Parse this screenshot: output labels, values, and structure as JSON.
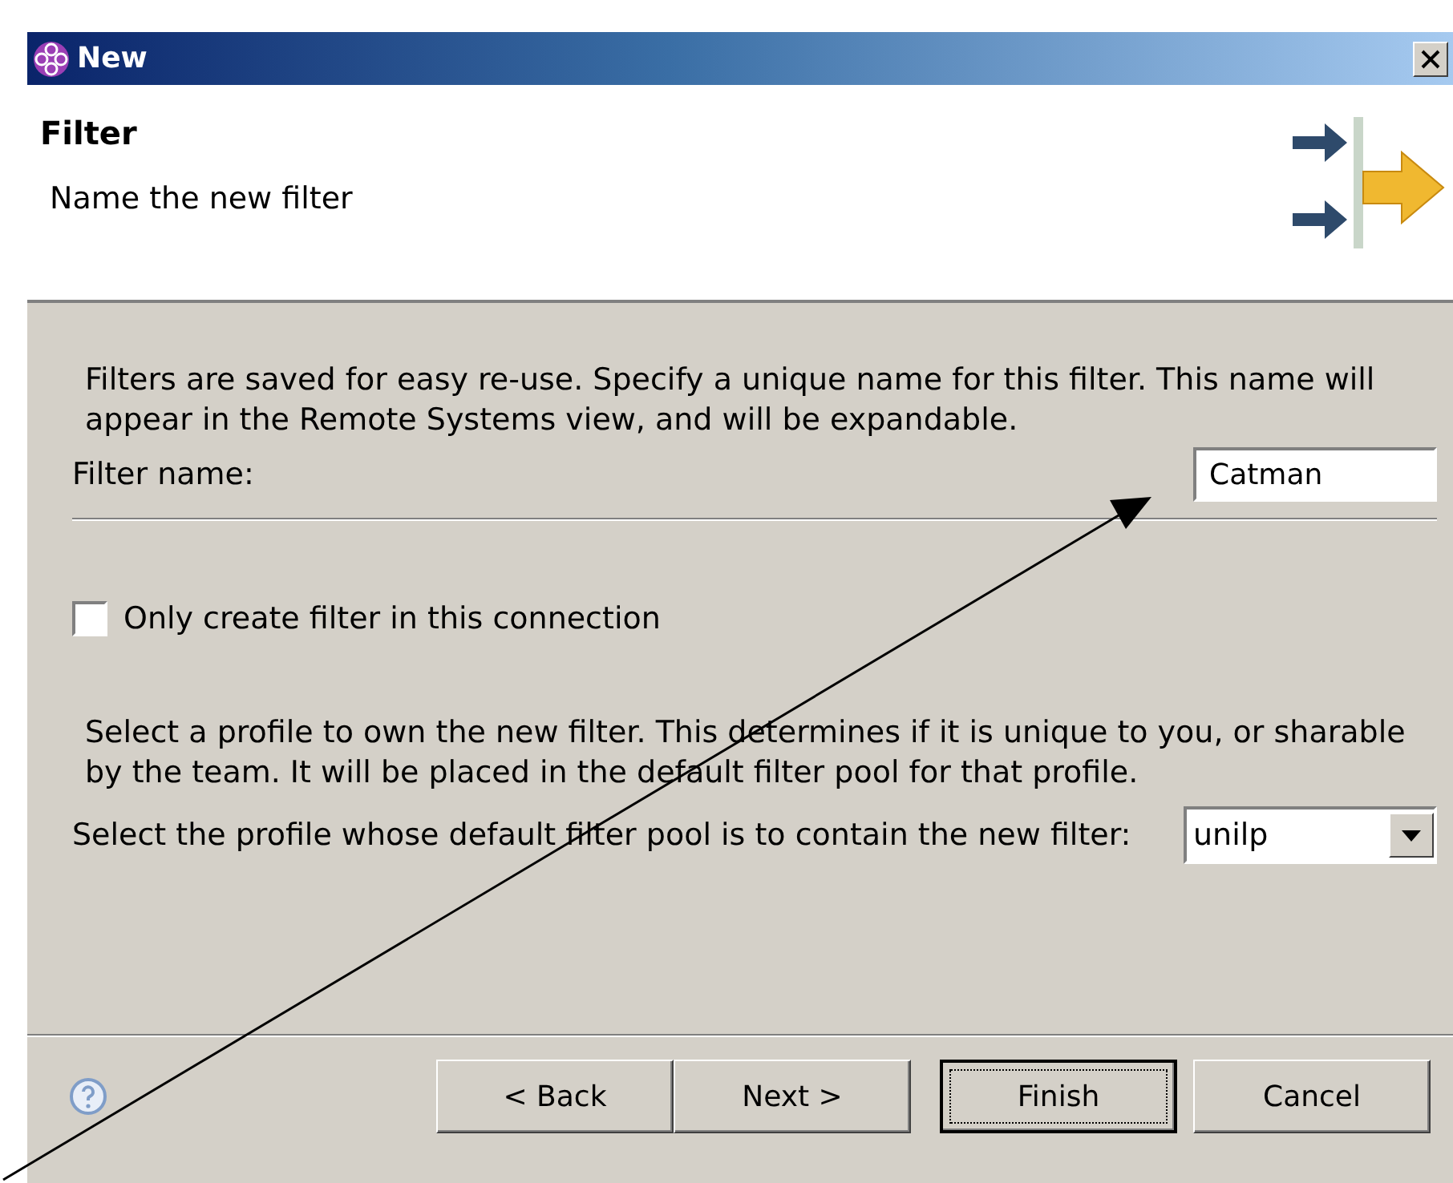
{
  "window": {
    "title": "New"
  },
  "header": {
    "title": "Filter",
    "subtitle": "Name the new filter"
  },
  "intro": "Filters are saved for easy re-use. Specify a unique name for this filter. This name will appear in the Remote Systems view, and will be expandable.",
  "filter_name": {
    "label": "Filter name:",
    "value": "Catman"
  },
  "only_connection": {
    "label": "Only create filter in this connection",
    "checked": false
  },
  "profile_intro": "Select a profile to own the new filter. This determines if it is unique to you, or sharable by the team. It will be placed in the default filter pool for that profile.",
  "profile": {
    "label": "Select the profile whose default filter pool is to contain the new filter:",
    "value": "unilp"
  },
  "buttons": [
    {
      "label": "< Back",
      "default": false
    },
    {
      "label": "Next >",
      "default": false
    },
    {
      "label": "Finish",
      "default": true
    },
    {
      "label": "Cancel",
      "default": false
    }
  ]
}
